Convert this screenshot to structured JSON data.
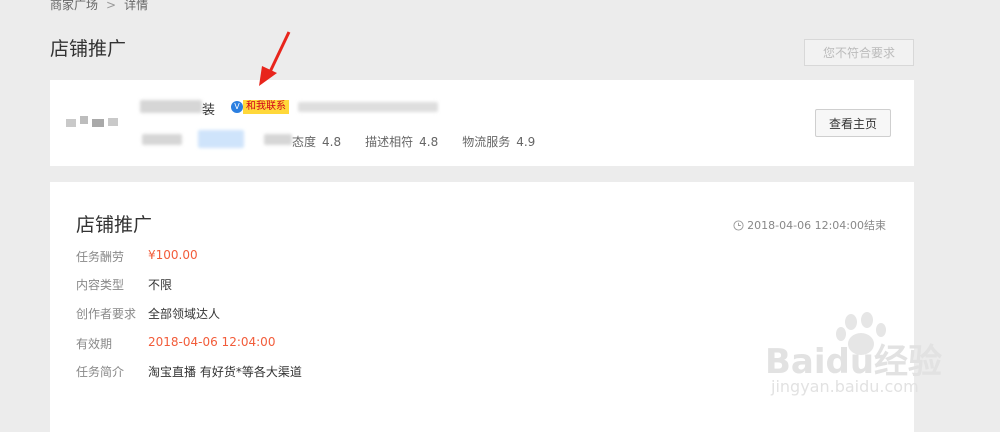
{
  "breadcrumb": {
    "parent": "商家广场",
    "separator": ">",
    "current": "详情"
  },
  "page": {
    "title": "店铺推广",
    "not_eligible_label": "您不符合要求"
  },
  "shop": {
    "name_tail": "装",
    "contact_tag": "和我联系",
    "ratings": [
      {
        "label": "态度",
        "value": "4.8"
      },
      {
        "label": "描述相符",
        "value": "4.8"
      },
      {
        "label": "物流服务",
        "value": "4.9"
      }
    ],
    "view_home_label": "查看主页"
  },
  "task": {
    "title": "店铺推广",
    "end_time": "2018-04-06 12:04:00结束",
    "fields": [
      {
        "label": "任务酬劳",
        "value": "¥100.00",
        "highlight": true
      },
      {
        "label": "内容类型",
        "value": "不限",
        "highlight": false
      },
      {
        "label": "创作者要求",
        "value": "全部领域达人",
        "highlight": false
      },
      {
        "label": "有效期",
        "value": "2018-04-06 12:04:00",
        "highlight": true
      },
      {
        "label": "任务简介",
        "value": "淘宝直播 有好货*等各大渠道",
        "highlight": false
      }
    ]
  },
  "watermark": {
    "brand": "Baidu经验",
    "url": "jingyan.baidu.com"
  },
  "colors": {
    "accent_red": "#f25c3a",
    "tag_yellow": "#ffd83a",
    "arrow_red": "#e8251c"
  }
}
